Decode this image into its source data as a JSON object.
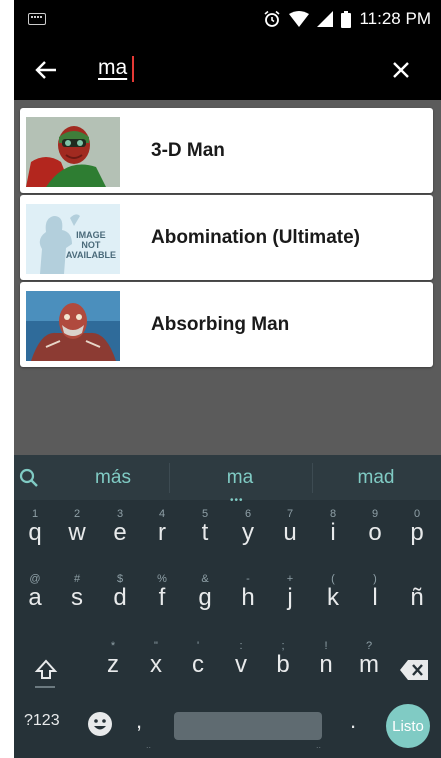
{
  "status_bar": {
    "time": "11:28 PM"
  },
  "search": {
    "query": "ma"
  },
  "results": [
    {
      "name": "3-D Man",
      "thumb": "3d-man-thumbnail"
    },
    {
      "name": "Abomination (Ultimate)",
      "thumb": "image-not-available-thumbnail",
      "thumb_text": [
        "IMAGE",
        "NOT",
        "AVAILABLE"
      ]
    },
    {
      "name": "Absorbing Man",
      "thumb": "absorbing-man-thumbnail"
    }
  ],
  "keyboard": {
    "suggestions": [
      "más",
      "ma",
      "mad"
    ],
    "row1": [
      {
        "k": "q",
        "h": "1"
      },
      {
        "k": "w",
        "h": "2"
      },
      {
        "k": "e",
        "h": "3"
      },
      {
        "k": "r",
        "h": "4"
      },
      {
        "k": "t",
        "h": "5"
      },
      {
        "k": "y",
        "h": "6"
      },
      {
        "k": "u",
        "h": "7"
      },
      {
        "k": "i",
        "h": "8"
      },
      {
        "k": "o",
        "h": "9"
      },
      {
        "k": "p",
        "h": "0"
      }
    ],
    "row2": [
      {
        "k": "a",
        "h": "@"
      },
      {
        "k": "s",
        "h": "#"
      },
      {
        "k": "d",
        "h": "$"
      },
      {
        "k": "f",
        "h": "%"
      },
      {
        "k": "g",
        "h": "&"
      },
      {
        "k": "h",
        "h": "-"
      },
      {
        "k": "j",
        "h": "+"
      },
      {
        "k": "k",
        "h": "("
      },
      {
        "k": "l",
        "h": ")"
      },
      {
        "k": "ñ",
        "h": ""
      }
    ],
    "row3": [
      {
        "k": "z",
        "h": "*"
      },
      {
        "k": "x",
        "h": "\""
      },
      {
        "k": "c",
        "h": "'"
      },
      {
        "k": "v",
        "h": ":"
      },
      {
        "k": "b",
        "h": ";"
      },
      {
        "k": "n",
        "h": "!"
      },
      {
        "k": "m",
        "h": "?"
      }
    ],
    "symbols_label": "?123",
    "comma": ",",
    "period": ".",
    "done_label": "Listo"
  },
  "colors": {
    "accent": "#80cbc4",
    "keyboard_bg": "#263238",
    "app_bar": "#000000"
  }
}
